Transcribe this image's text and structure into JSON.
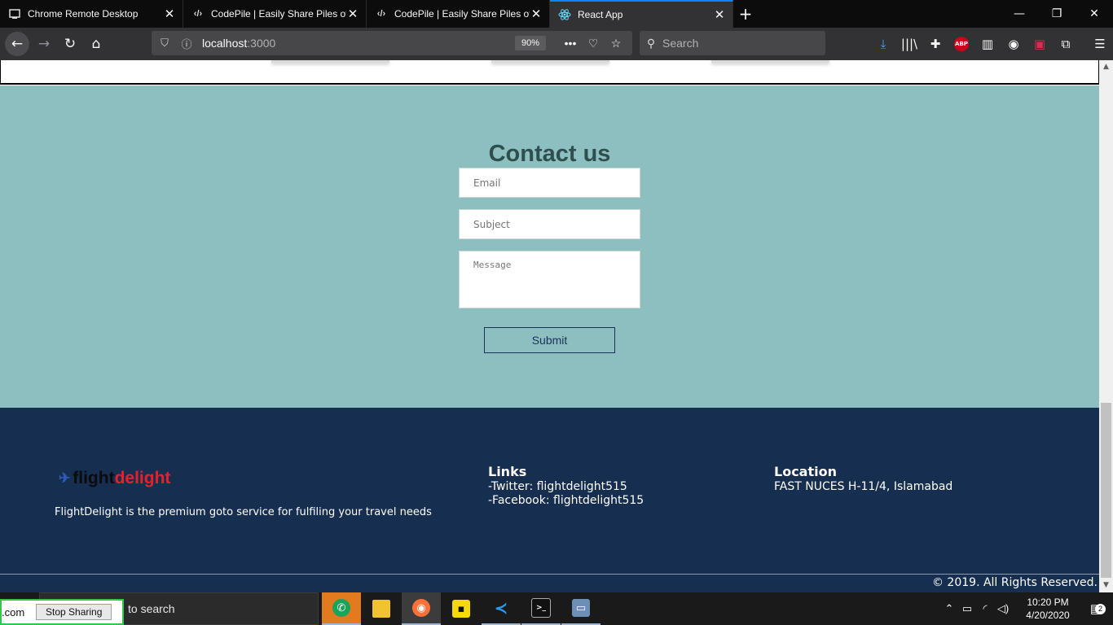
{
  "browser": {
    "tabs": [
      {
        "title": "Chrome Remote Desktop",
        "icon": "remote-desktop-icon",
        "active": false
      },
      {
        "title": "CodePile | Easily Share Piles of",
        "icon": "codepile-icon",
        "active": false
      },
      {
        "title": "CodePile | Easily Share Piles of",
        "icon": "codepile-icon",
        "active": false
      },
      {
        "title": "React App",
        "icon": "react-icon",
        "active": true
      }
    ],
    "url_host": "localhost",
    "url_port": ":3000",
    "zoom": "90%",
    "search_placeholder": "Search",
    "abp_label": "ABP"
  },
  "contact": {
    "heading": "Contact us",
    "email_placeholder": "Email",
    "subject_placeholder": "Subject",
    "message_placeholder": "Message",
    "submit_label": "Submit",
    "background": "#8dbfc0"
  },
  "footer": {
    "logo_word1": "flight",
    "logo_word2": "delight",
    "tagline": "FlightDelight is the premium goto service for fulfiling your travel needs",
    "links_title": "Links",
    "links": [
      "-Twitter: flightdelight515",
      "-Facebook: flightdelight515"
    ],
    "location_title": "Location",
    "location": "FAST NUCES H-11/4, Islamabad",
    "copyright": "© 2019. All Rights Reserved.",
    "background": "#162e4f",
    "brand_red": "#e8202a"
  },
  "taskbar": {
    "share_domain": ".com",
    "stop_sharing": "Stop Sharing",
    "search_text": "to search",
    "time": "10:20 PM",
    "date": "4/20/2020",
    "notification_count": "2"
  }
}
